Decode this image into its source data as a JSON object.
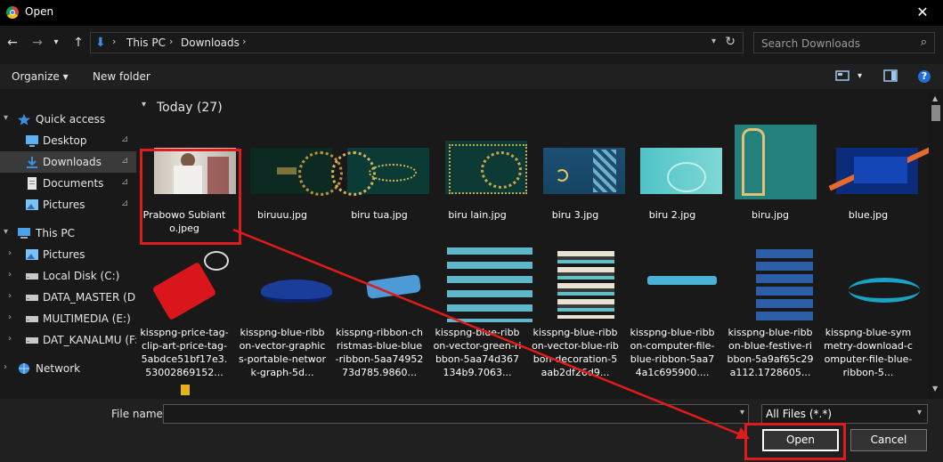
{
  "window": {
    "title": "Open",
    "close_glyph": "✕"
  },
  "nav_buttons": {
    "back": "←",
    "forward": "→",
    "recent": "▾",
    "up": "↑"
  },
  "address": {
    "crumbs": [
      "This PC",
      "Downloads"
    ],
    "sep": "›",
    "dropdown": "▾",
    "refresh": "↻"
  },
  "search": {
    "placeholder": "Search Downloads",
    "icon": "⌕"
  },
  "toolbar": {
    "organize": "Organize ▾",
    "new_folder": "New folder",
    "view_dd": "▾",
    "help": "?"
  },
  "sidebar": {
    "items": [
      {
        "label": "Quick access",
        "icon": "star",
        "indent": 0,
        "expander": "▾",
        "pinned": false,
        "selected": false
      },
      {
        "label": "Desktop",
        "icon": "desktop",
        "indent": 1,
        "expander": "",
        "pinned": true,
        "selected": false
      },
      {
        "label": "Downloads",
        "icon": "download",
        "indent": 1,
        "expander": "",
        "pinned": true,
        "selected": true
      },
      {
        "label": "Documents",
        "icon": "document",
        "indent": 1,
        "expander": "",
        "pinned": true,
        "selected": false
      },
      {
        "label": "Pictures",
        "icon": "pictures",
        "indent": 1,
        "expander": "",
        "pinned": true,
        "selected": false
      },
      {
        "label": "This PC",
        "icon": "computer",
        "indent": 0,
        "expander": "▾",
        "pinned": false,
        "selected": false
      },
      {
        "label": "Pictures",
        "icon": "pictures",
        "indent": 1,
        "expander": "›",
        "pinned": false,
        "selected": false
      },
      {
        "label": "Local Disk (C:)",
        "icon": "drive",
        "indent": 1,
        "expander": "›",
        "pinned": false,
        "selected": false
      },
      {
        "label": "DATA_MASTER (D:)",
        "icon": "drive",
        "indent": 1,
        "expander": "›",
        "pinned": false,
        "selected": false
      },
      {
        "label": "MULTIMEDIA (E:)",
        "icon": "drive",
        "indent": 1,
        "expander": "›",
        "pinned": false,
        "selected": false
      },
      {
        "label": "DAT_KANALMU (F:)",
        "icon": "drive",
        "indent": 1,
        "expander": "›",
        "pinned": false,
        "selected": false
      },
      {
        "label": "Network",
        "icon": "network",
        "indent": 0,
        "expander": "›",
        "pinned": false,
        "selected": false
      }
    ],
    "pin_glyph": "📌"
  },
  "group": {
    "label": "Today (27)",
    "chevron": "▾"
  },
  "files": [
    {
      "name": "Prabowo Subianto.jpeg",
      "thumb": "photo"
    },
    {
      "name": "biruuu.jpg",
      "thumb": "darkgreen-mandala"
    },
    {
      "name": "biru tua.jpg",
      "thumb": "teal-mandala"
    },
    {
      "name": "biru lain.jpg",
      "thumb": "gold-frame"
    },
    {
      "name": "biru 3.jpg",
      "thumb": "islamic-blue"
    },
    {
      "name": "biru 2.jpg",
      "thumb": "light-teal"
    },
    {
      "name": "biru.jpg",
      "thumb": "teal-arch"
    },
    {
      "name": "blue.jpg",
      "thumb": "navy-stripes"
    },
    {
      "name": "kisspng-price-tag-clip-art-price-tag-5abdce51bf17e3.53002869152...",
      "thumb": "red-tag"
    },
    {
      "name": "kisspng-blue-ribbon-vector-graphics-portable-network-graph-5d...",
      "thumb": "blue-ribbon"
    },
    {
      "name": "kisspng-ribbon-christmas-blue-blue-ribbon-5aa7495273d785.9860...",
      "thumb": "ribbon-single"
    },
    {
      "name": "kisspng-blue-ribbon-vector-green-ribbon-5aa74d367134b9.7063...",
      "thumb": "ribbon-set"
    },
    {
      "name": "kisspng-blue-ribbon-vector-blue-ribbon-decoration-5aab2df26d9...",
      "thumb": "ribbon-stack"
    },
    {
      "name": "kisspng-blue-ribbon-computer-file-blue-ribbon-5aa74a1c695900....",
      "thumb": "ribbon-thin"
    },
    {
      "name": "kisspng-blue-ribbon-blue-festive-ribbon-5a9af65c29a112.1728605...",
      "thumb": "ribbon-banners"
    },
    {
      "name": "kisspng-blue-symmetry-download-computer-file-blue-ribbon-5...",
      "thumb": "ribbon-wave"
    }
  ],
  "footer": {
    "file_name_label": "File name:",
    "file_name_value": "",
    "filter_value": "All Files (*.*)",
    "open_label": "Open",
    "cancel_label": "Cancel"
  },
  "colors": {
    "annotation": "#e01b1b",
    "accent": "#3c8fe0"
  }
}
